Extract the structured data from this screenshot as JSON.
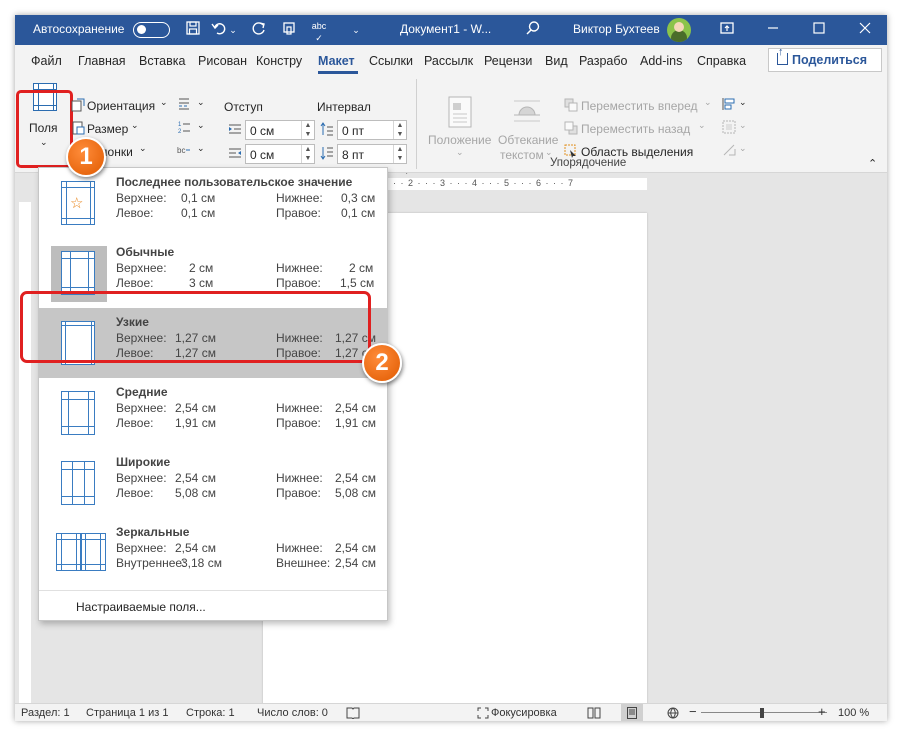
{
  "titlebar": {
    "autosave_label": "Автосохранение",
    "document_title": "Документ1 - W...",
    "user_name": "Виктор Бухтеев",
    "icons": [
      "save-icon",
      "undo-icon",
      "redo-icon",
      "touch-mode-icon",
      "spelling-icon",
      "search-icon",
      "ribbon-display-icon",
      "minimize-icon",
      "maximize-icon",
      "close-icon"
    ]
  },
  "tabs": [
    {
      "label": "Файл"
    },
    {
      "label": "Главная"
    },
    {
      "label": "Вставка"
    },
    {
      "label": "Рисован"
    },
    {
      "label": "Констру"
    },
    {
      "label": "Макет"
    },
    {
      "label": "Ссылки"
    },
    {
      "label": "Рассылк"
    },
    {
      "label": "Рецензи"
    },
    {
      "label": "Вид"
    },
    {
      "label": "Разрабо"
    },
    {
      "label": "Add-ins"
    },
    {
      "label": "Справка"
    }
  ],
  "share_label": "Поделиться",
  "ribbon": {
    "fields_label": "Поля",
    "orientation_label": "Ориентация",
    "size_label": "Размер",
    "columns_label": "Колонки",
    "indent_label": "Отступ",
    "interval_label": "Интервал",
    "indent_left": "0 см",
    "indent_right": "0 см",
    "spacing_before": "0 пт",
    "spacing_after": "8 пт",
    "position_label": "Положение",
    "wrap_label_1": "Обтекание",
    "wrap_label_2": "текстом",
    "bring_forward": "Переместить вперед",
    "send_backward": "Переместить назад",
    "selection_pane": "Область выделения",
    "arrange_group": "Упорядочение"
  },
  "fields_menu": {
    "options": [
      {
        "name": "Последнее пользовательское значение",
        "k1": "Верхнее:",
        "v1": "0,1 см",
        "k2": "Нижнее:",
        "v2": "0,3 см",
        "k3": "Левое:",
        "v3": "0,1 см",
        "k4": "Правое:",
        "v4": "0,1 см"
      },
      {
        "name": "Обычные",
        "k1": "Верхнее:",
        "v1": "2 см",
        "k2": "Нижнее:",
        "v2": "2 см",
        "k3": "Левое:",
        "v3": "3 см",
        "k4": "Правое:",
        "v4": "1,5 см"
      },
      {
        "name": "Узкие",
        "k1": "Верхнее:",
        "v1": "1,27 см",
        "k2": "Нижнее:",
        "v2": "1,27 см",
        "k3": "Левое:",
        "v3": "1,27 см",
        "k4": "Правое:",
        "v4": "1,27 см"
      },
      {
        "name": "Средние",
        "k1": "Верхнее:",
        "v1": "2,54 см",
        "k2": "Нижнее:",
        "v2": "2,54 см",
        "k3": "Левое:",
        "v3": "1,91 см",
        "k4": "Правое:",
        "v4": "1,91 см"
      },
      {
        "name": "Широкие",
        "k1": "Верхнее:",
        "v1": "2,54 см",
        "k2": "Нижнее:",
        "v2": "2,54 см",
        "k3": "Левое:",
        "v3": "5,08 см",
        "k4": "Правое:",
        "v4": "5,08 см"
      },
      {
        "name": "Зеркальные",
        "k1": "Верхнее:",
        "v1": "2,54 см",
        "k2": "Нижнее:",
        "v2": "2,54 см",
        "k3": "Внутреннее:",
        "v3": "3,18 см",
        "k4": "Внешнее:",
        "v4": "2,54 см"
      }
    ],
    "custom_label": "Настраиваемые поля..."
  },
  "annotations": {
    "step1": "1",
    "step2": "2"
  },
  "ruler_ticks": "1 · · · 2 · · · 3 · · · 4 · · · 5 · · · 6 · · · 7",
  "status": {
    "section": "Раздел: 1",
    "page": "Страница 1 из 1",
    "line": "Строка: 1",
    "words": "Число слов: 0",
    "focus": "Фокусировка",
    "zoom": "100 %",
    "zoom_minus": "−",
    "zoom_plus": "+"
  },
  "colors": {
    "accent": "#2b579a",
    "highlight": "#e02020",
    "badge": "#f07010"
  }
}
